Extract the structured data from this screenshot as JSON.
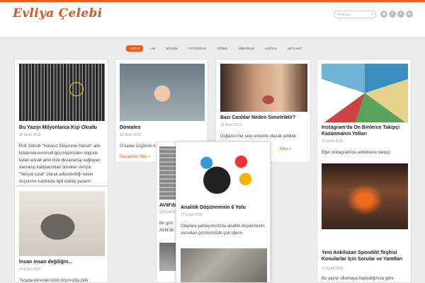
{
  "site": {
    "logo": "Evliya Çelebi",
    "search_placeholder": "Arama..."
  },
  "social": [
    "rss-icon",
    "facebook-icon",
    "twitter-icon",
    "linkedin-icon"
  ],
  "nav": [
    "HEPSİ",
    "ANI",
    "BİLİŞİM",
    "FOTOĞRAF",
    "GENEL",
    "MİMARLIK",
    "SAĞLIK",
    "SEYAHAT"
  ],
  "posts": {
    "p1": {
      "title": "Bu Yazıyı Milyonlarca Kişi Okudu",
      "date": "16 Ekim 2015",
      "excerpt": "Rolf Dobelli \"Hatasız Düşünme Sanatı\" adlı kitabında evrimsel geçmişimizden bugüne kalan ancak artık bize dezavantaj sağlayan davranış kalıplarından örnekler veriyor. \"Sosyal ispat\" olarak adlandırdığı hatalı düşünme kalıbında ilgili olarak yazarın"
    },
    "p2": {
      "title": "Domates",
      "date": "15 Ekim 2015",
      "excerpt": "O kadar üzgündü ki elmalarını ona ve",
      "more": "Devamını Oku »"
    },
    "p3": {
      "title": "Bazı Canlılar Neden Simetriktir?",
      "date": "13 Ekim 2015",
      "excerpt": "Doğanın her şeyi simetrik olacak şekilde yarattığı konusu kaygısı",
      "more": "Oku »"
    },
    "p4": {
      "title": "Instagram'da On Binlerce Takipçi Kazanmanın Yolları",
      "date": "13 Ekim 2015",
      "excerpt": "Eğer Instagram'da onbinlerce takipçi"
    },
    "p5": {
      "title": "İnsan insan değiliğin...",
      "date": "14 Eylül 2015",
      "excerpt": "\"Acaba evrende birim dışımızda zeki"
    },
    "p6": {
      "title": "AVM'de",
      "date": "24 Eylül 2",
      "excerpt": "Bir gün AVM'de"
    },
    "p7": {
      "title": "Analitik Düşünmenin 6 Yolu",
      "date": "17 Eylül 2015",
      "excerpt": "Olaylara yaklaşımınızda analitik düşünmenin sorunları çözmemizde çok işlerin"
    },
    "p8": {
      "title": "Yeni Ankilozan Spondilit Teşhisi Konularlar İçin Sorular ve Yanıtları",
      "date": "17 Eylül 2015",
      "excerpt": "Bu yazıyı okumaya başladığınıza göre"
    }
  }
}
